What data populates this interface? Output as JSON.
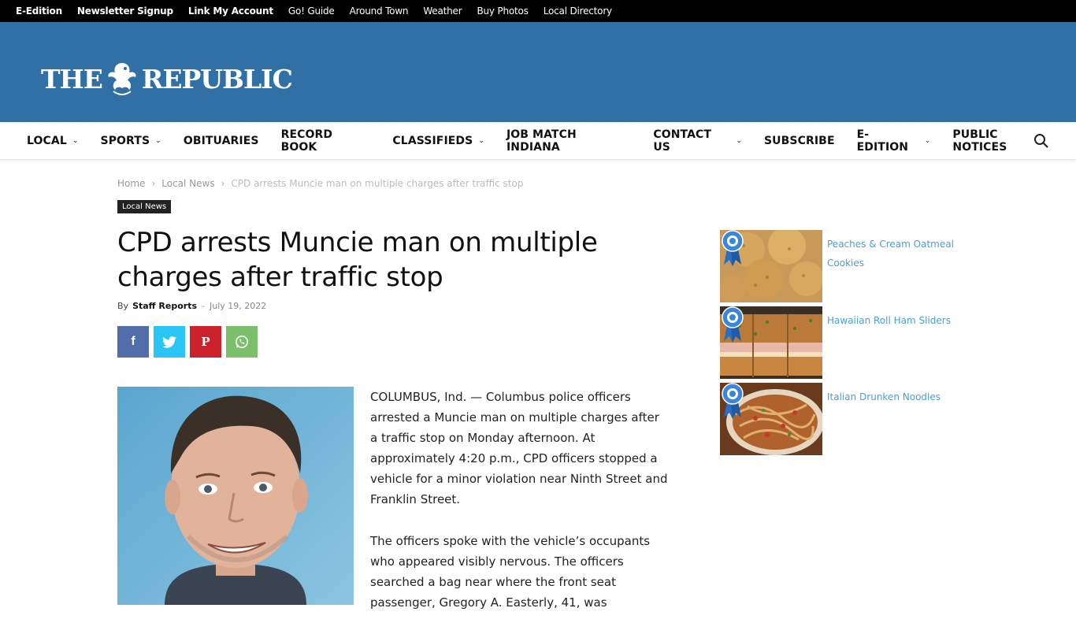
{
  "topbar": {
    "links": [
      "E-Edition",
      "Newsletter Signup",
      "Link My Account",
      "Go! Guide",
      "Around Town",
      "Weather",
      "Buy Photos",
      "Local Directory"
    ]
  },
  "logo": {
    "left": "THE",
    "right": "REPUBLIC"
  },
  "nav": {
    "items": [
      {
        "label": "LOCAL",
        "dropdown": true
      },
      {
        "label": "SPORTS",
        "dropdown": true
      },
      {
        "label": "OBITUARIES",
        "dropdown": false
      },
      {
        "label": "RECORD BOOK",
        "dropdown": false
      },
      {
        "label": "CLASSIFIEDS",
        "dropdown": true
      },
      {
        "label": "JOB MATCH INDIANA",
        "dropdown": false
      },
      {
        "label": "CONTACT US",
        "dropdown": true
      },
      {
        "label": "SUBSCRIBE",
        "dropdown": false
      },
      {
        "label": "E-EDITION",
        "dropdown": true
      },
      {
        "label": "PUBLIC NOTICES",
        "dropdown": false
      }
    ]
  },
  "breadcrumb": {
    "home": "Home",
    "section": "Local News",
    "current": "CPD arrests Muncie man on multiple charges after traffic stop"
  },
  "article": {
    "category": "Local News",
    "title": "CPD arrests Muncie man on multiple charges after traffic stop",
    "by": "By",
    "author": "Staff Reports",
    "dash": "-",
    "date": "July 19, 2022",
    "paragraphs": [
      "COLUMBUS, Ind. — Columbus police officers arrested a Muncie man on multiple charges after a traffic stop on Monday afternoon. At approximately 4:20 p.m., CPD officers stopped a vehicle for a minor violation near Ninth Street and Franklin Street.",
      "The officers spoke with the vehicle’s occupants who appeared visibly nervous. The officers searched a bag near where the front seat passenger, Gregory A. Easterly, 41, was"
    ]
  },
  "share": {
    "facebook": "f",
    "twitter": "t",
    "pinterest": "P",
    "whatsapp": "w"
  },
  "sidebar": {
    "recipes": [
      {
        "label": "Peaches & Cream Oatmeal Cookies"
      },
      {
        "label": "Hawaiian Roll Ham Sliders"
      },
      {
        "label": "Italian Drunken Noodles"
      }
    ]
  },
  "colors": {
    "masthead": "#3170a5",
    "link": "#4a9fd6",
    "facebook": "#516eab",
    "twitter": "#29c5f6",
    "pinterest": "#ca212a",
    "whatsapp": "#7bbf6a"
  }
}
